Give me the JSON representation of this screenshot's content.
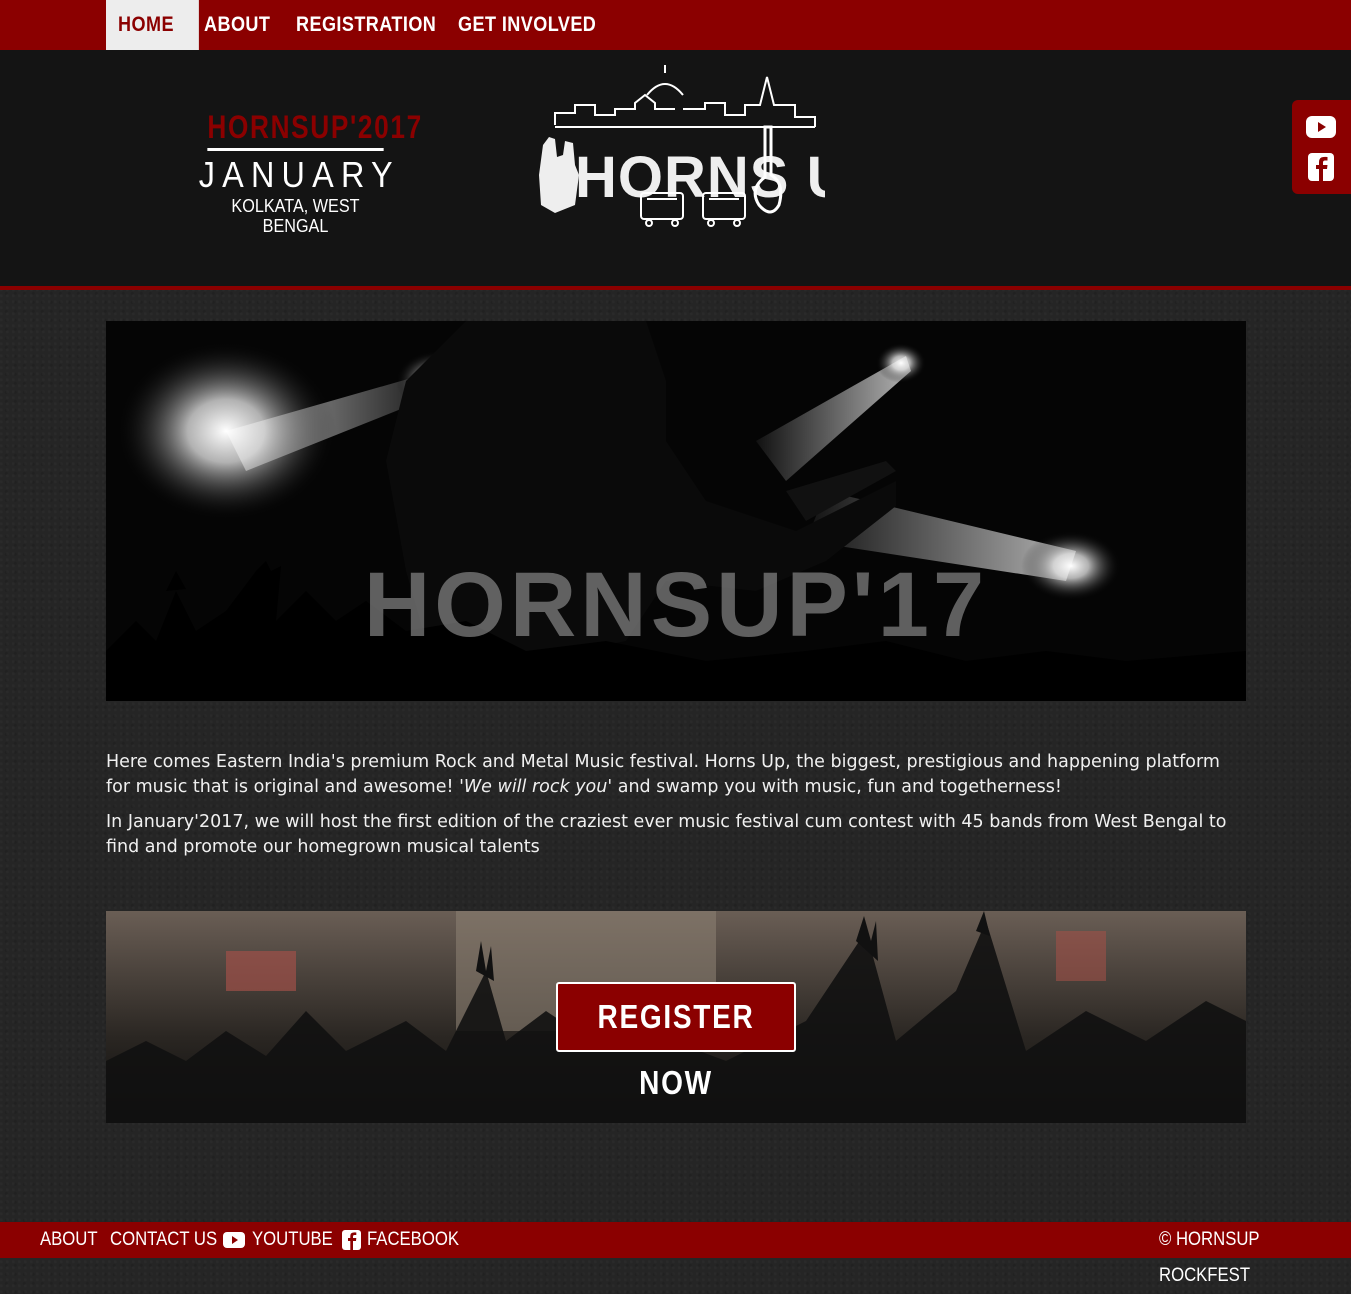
{
  "nav": {
    "items": [
      {
        "label": "HOME",
        "active": true
      },
      {
        "label": "ABOUT"
      },
      {
        "label": "REGISTRATION"
      },
      {
        "label": "GET INVOLVED"
      }
    ]
  },
  "header": {
    "year": "HORNSUP'2017",
    "month": "JANUARY",
    "place": "KOLKATA, WEST BENGAL",
    "logo_text": "HORNS UP"
  },
  "social": {
    "youtube_icon": "youtube-icon",
    "facebook_icon": "facebook-icon"
  },
  "hero": {
    "title": "HORNSUP'17"
  },
  "intro": {
    "p1_start": "Here comes Eastern India's premium Rock and Metal Music festival. Horns Up, the biggest, prestigious and happening platform for music that is original and awesome! ",
    "p1_italic": "'We will rock you'",
    "p1_end": " and swamp you with music, fun and togetherness!",
    "p2": "In January'2017, we will host the first edition of the craziest ever music festival cum contest with 45 bands from West Bengal to find and promote our homegrown musical talents"
  },
  "cta": {
    "label": "REGISTER NOW"
  },
  "footer": {
    "about": "ABOUT",
    "contact": "CONTACT US",
    "youtube": "YOUTUBE",
    "facebook": "FACEBOOK",
    "copyright": "© HORNSUP ROCKFEST"
  },
  "colors": {
    "brand": "#8b0000",
    "header_bg": "#141414",
    "page_bg": "#252525"
  }
}
